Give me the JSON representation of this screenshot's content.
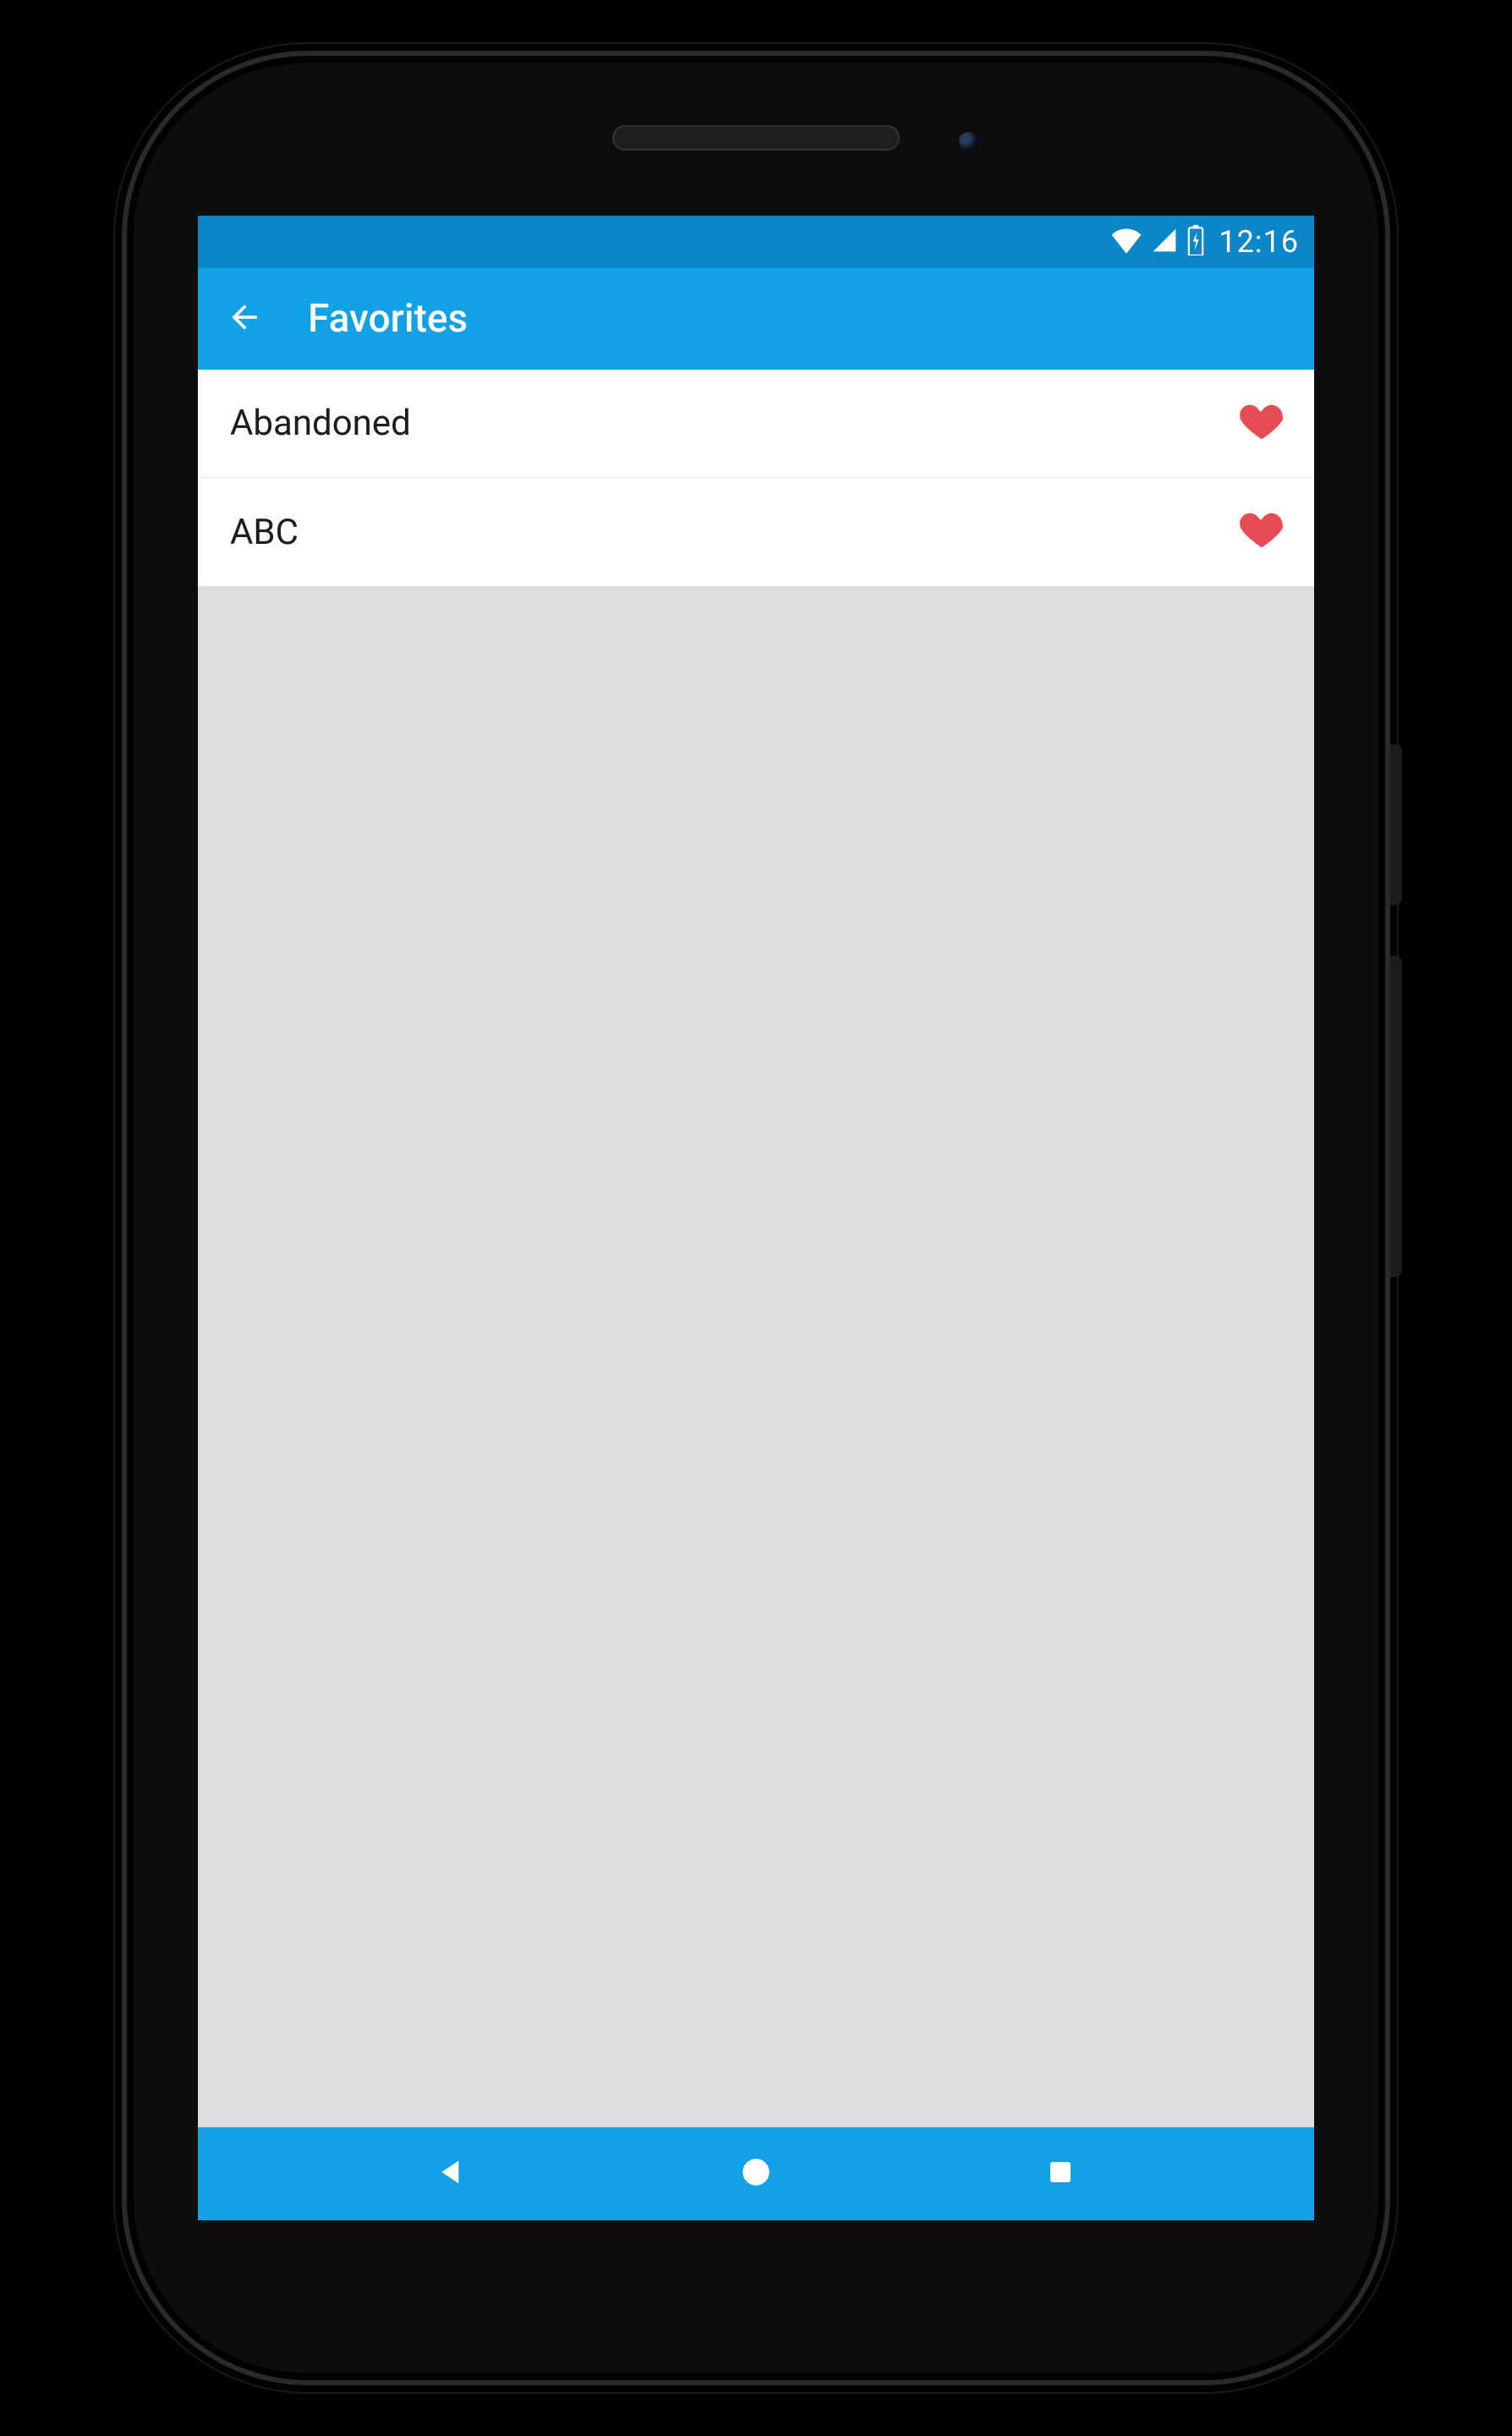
{
  "statusbar": {
    "time": "12:16"
  },
  "appbar": {
    "title": "Favorites"
  },
  "favorites": {
    "items": [
      {
        "label": "Abandoned"
      },
      {
        "label": "ABC"
      }
    ]
  }
}
